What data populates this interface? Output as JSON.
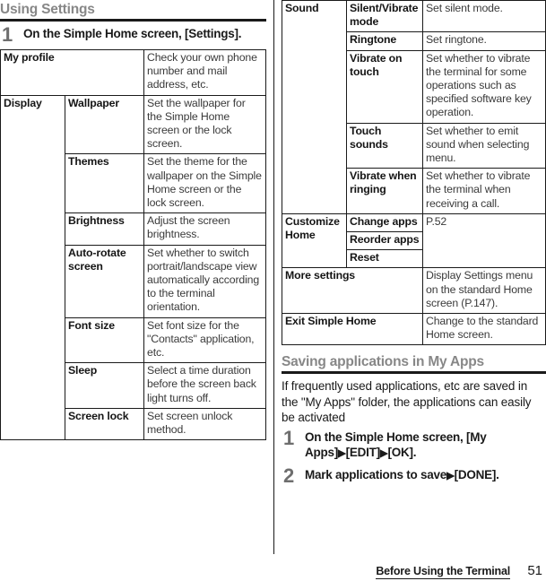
{
  "left_column": {
    "heading": "Using Settings",
    "steps": [
      {
        "number": "1",
        "text": "On the Simple Home screen, [Settings]."
      }
    ],
    "table": {
      "rows": [
        {
          "type": "span2",
          "key": "My profile",
          "value": "Check your own phone number and mail address, etc."
        },
        {
          "type": "group",
          "group": "Display",
          "items": [
            {
              "key": "Wallpaper",
              "value": "Set the wallpaper for the Simple Home screen or the lock screen."
            },
            {
              "key": "Themes",
              "value": "Set the theme for the wallpaper on the Simple Home screen or the lock screen."
            },
            {
              "key": "Brightness",
              "value": "Adjust the screen brightness."
            },
            {
              "key": "Auto-rotate screen",
              "value": "Set whether to switch portrait/landscape view automatically according to the terminal orientation."
            },
            {
              "key": "Font size",
              "value": "Set font size for the \"Contacts\" application, etc."
            },
            {
              "key": "Sleep",
              "value": "Select a time duration before the screen back light turns off."
            },
            {
              "key": "Screen lock",
              "value": "Set screen unlock method."
            }
          ]
        }
      ]
    }
  },
  "right_column": {
    "table": {
      "rows": [
        {
          "type": "group",
          "group": "Sound",
          "items": [
            {
              "key": "Silent/Vibrate mode",
              "value": "Set silent mode."
            },
            {
              "key": "Ringtone",
              "value": "Set ringtone."
            },
            {
              "key": "Vibrate on touch",
              "value": "Set whether to vibrate the terminal for some operations such as specified software key operation."
            },
            {
              "key": "Touch sounds",
              "value": "Set whether to emit sound when selecting menu."
            },
            {
              "key": "Vibrate when ringing",
              "value": "Set whether to vibrate the terminal when receiving a call."
            }
          ]
        },
        {
          "type": "group-shared-value",
          "group": "Customize Home",
          "items": [
            {
              "key": "Change apps"
            },
            {
              "key": "Reorder apps"
            },
            {
              "key": "Reset"
            }
          ],
          "value": "P.52"
        },
        {
          "type": "span2",
          "key": "More settings",
          "value": "Display Settings menu on the standard Home screen (P.147)."
        },
        {
          "type": "span2",
          "key": "Exit Simple Home",
          "value": "Change to the standard Home screen."
        }
      ]
    },
    "heading": "Saving applications in My Apps",
    "intro": "If frequently used applications, etc are saved in the \"My Apps\" folder, the applications can easily be activated",
    "steps": [
      {
        "number": "1",
        "text_before": "On the Simple Home screen, [My Apps]",
        "arrow1": "▶",
        "text_mid": "[EDIT]",
        "arrow2": "▶",
        "text_after": "[OK]."
      },
      {
        "number": "2",
        "text_before": "Mark applications to save",
        "arrow1": "▶",
        "text_after": "[DONE]."
      }
    ]
  },
  "footer": {
    "title": "Before Using the Terminal",
    "page_number": "51"
  }
}
